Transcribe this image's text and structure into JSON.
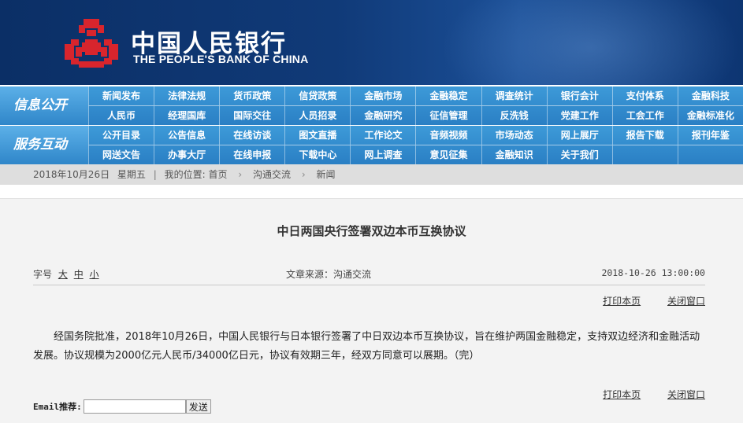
{
  "colors": {
    "banner": "#0b2f66",
    "nav": "#2a7fc4",
    "logo_red": "#d8252d",
    "breadcrumb_bg": "#dedede",
    "content_bg": "#f3f3f3"
  },
  "header": {
    "bank_name_cn": "中国人民银行",
    "bank_name_en": "THE PEOPLE'S BANK OF CHINA",
    "logo_icon": "pboc-logo-icon"
  },
  "nav": {
    "group1": {
      "label": "信息公开",
      "items": [
        "新闻发布",
        "法律法规",
        "货币政策",
        "信贷政策",
        "金融市场",
        "金融稳定",
        "调查统计",
        "银行会计",
        "支付体系",
        "金融科技",
        "人民币",
        "经理国库",
        "国际交往",
        "人员招录",
        "金融研究",
        "征信管理",
        "反洗钱",
        "党建工作",
        "工会工作",
        "金融标准化"
      ]
    },
    "group2": {
      "label": "服务互动",
      "items": [
        "公开目录",
        "公告信息",
        "在线访谈",
        "图文直播",
        "工作论文",
        "音频视频",
        "市场动态",
        "网上展厅",
        "报告下载",
        "报刊年鉴",
        "网送文告",
        "办事大厅",
        "在线申报",
        "下载中心",
        "网上调查",
        "意见征集",
        "金融知识",
        "关于我们",
        "",
        ""
      ]
    }
  },
  "breadcrumb": {
    "date": "2018年10月26日",
    "weekday": "星期五",
    "location_label": "我的位置:",
    "home": "首页",
    "section": "沟通交流",
    "current": "新闻"
  },
  "article": {
    "title": "中日两国央行签署双边本币互换协议",
    "font_size_label": "字号",
    "font_large": "大",
    "font_medium": "中",
    "font_small": "小",
    "source": "文章来源：沟通交流",
    "datetime": "2018-10-26  13:00:00",
    "print_label": "打印本页",
    "close_label": "关闭窗口",
    "body": "经国务院批准，2018年10月26日，中国人民银行与日本银行签署了中日双边本币互换协议，旨在维护两国金融稳定，支持双边经济和金融活动发展。协议规模为2000亿元人民币/34000亿日元，协议有效期三年，经双方同意可以展期。（完）"
  },
  "email": {
    "label": "Email推荐:",
    "value": "",
    "button": "发送"
  }
}
